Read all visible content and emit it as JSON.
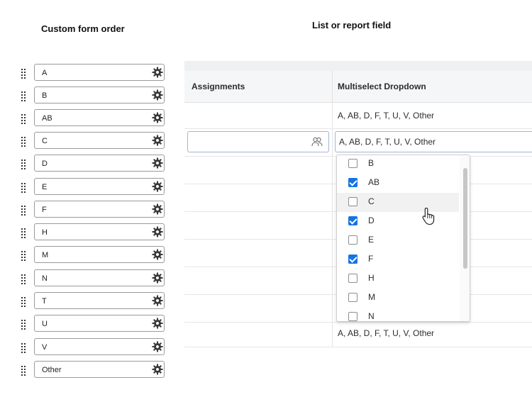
{
  "titles": {
    "left": "Custom form order",
    "right": "List or report field"
  },
  "form_options": [
    "A",
    "B",
    "AB",
    "C",
    "D",
    "E",
    "F",
    "H",
    "M",
    "N",
    "T",
    "U",
    "V",
    "Other"
  ],
  "table": {
    "headers": [
      "Assignments",
      "Multiselect Dropdown"
    ],
    "row_values": {
      "first": "A, AB, D, F, T, U, V, Other",
      "editing": "A, AB, D, F, T, U, V, Other",
      "last": "A, AB, D, F, T, U, V, Other"
    }
  },
  "dropdown": {
    "items": [
      {
        "label": "B",
        "checked": false
      },
      {
        "label": "AB",
        "checked": true
      },
      {
        "label": "C",
        "checked": false,
        "hovered": true
      },
      {
        "label": "D",
        "checked": true
      },
      {
        "label": "E",
        "checked": false
      },
      {
        "label": "F",
        "checked": true
      },
      {
        "label": "H",
        "checked": false
      },
      {
        "label": "M",
        "checked": false
      },
      {
        "label": "N",
        "checked": false
      }
    ]
  },
  "colors": {
    "accent": "#1473e6",
    "input_border": "#9fb6d8"
  },
  "icons": {
    "drag": "drag-handle-icon",
    "settings": "gear-icon",
    "people": "people-icon",
    "cursor": "hand-pointer-icon"
  }
}
